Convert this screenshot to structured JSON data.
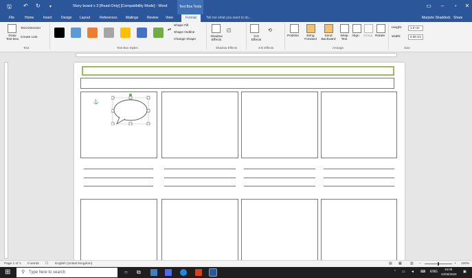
{
  "window": {
    "title": "Story board x 3 [Read-Only] [Compatibility Mode] - Word",
    "context_tab_title": "Text Box Tools",
    "controls": {
      "minimize": "–",
      "restore": "▫",
      "close": "✕"
    },
    "accent": "#2b579a"
  },
  "quick_access": {
    "save": "🖫",
    "undo": "↶",
    "redo": "↻",
    "customize": "▾"
  },
  "tabs": [
    {
      "label": "File"
    },
    {
      "label": "Home"
    },
    {
      "label": "Insert"
    },
    {
      "label": "Design"
    },
    {
      "label": "Layout"
    },
    {
      "label": "References"
    },
    {
      "label": "Mailings"
    },
    {
      "label": "Review"
    },
    {
      "label": "View"
    }
  ],
  "active_tab": "Format",
  "tell_me": "Tell me what you want to do...",
  "user": {
    "name": "Marjorie Shaddock",
    "share": "Share"
  },
  "ribbon": {
    "text": {
      "draw_text_box": "Draw Text Box",
      "text_direction": "Text Direction",
      "create_link": "Create Link",
      "group": "Text"
    },
    "styles": {
      "swatches": [
        "#000000",
        "#5b9bd5",
        "#ed7d31",
        "#a5a5a5",
        "#ffc000",
        "#4472c4",
        "#70ad47"
      ],
      "shape_fill": "Shape Fill",
      "shape_outline": "Shape Outline",
      "change_shape": "Change Shape",
      "group": "Text Box Styles"
    },
    "shadow": {
      "label": "Shadow Effects",
      "group": "Shadow Effects"
    },
    "effects3d": {
      "label": "3-D Effects",
      "group": "3-D Effects"
    },
    "arrange": {
      "position": "Position",
      "bring_forward": "Bring Forward",
      "send_backward": "Send Backward",
      "wrap_text": "Wrap Text",
      "align": "Align",
      "group_btn": "Group",
      "rotate": "Rotate",
      "group": "Arrange"
    },
    "size": {
      "height_label": "Height:",
      "height_value": "1.0 cm",
      "width_label": "Width:",
      "width_value": "2.00 cm",
      "group": "Size"
    }
  },
  "status": {
    "page": "Page 1 of 1",
    "words": "0 words",
    "language": "English (United Kingdom)",
    "zoom": "100%"
  },
  "taskbar": {
    "search_placeholder": "Type here to search",
    "language": "ENG",
    "time": "16:08",
    "date": "22/06/2020"
  }
}
